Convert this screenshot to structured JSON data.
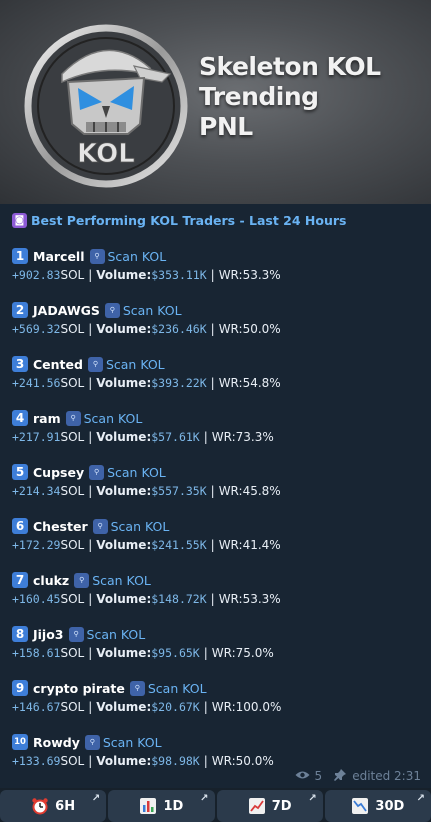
{
  "banner": {
    "title_lines": [
      "Skeleton KOL",
      "Trending",
      "PNL"
    ],
    "logo_text": "KOL"
  },
  "header": {
    "icon": "purple-square-icon",
    "text": "Best Performing KOL Traders - Last 24 Hours"
  },
  "labels": {
    "sol": "SOL",
    "volume": "Volume:",
    "wr": "WR:",
    "scan": "Scan KOL",
    "sep": "|"
  },
  "traders": [
    {
      "rank": "1",
      "name": "Marcell",
      "pnl": "+902.83",
      "volume": "$353.11K",
      "wr": "53.3%"
    },
    {
      "rank": "2",
      "name": "JADAWGS",
      "pnl": "+569.32",
      "volume": "$236.46K",
      "wr": "50.0%"
    },
    {
      "rank": "3",
      "name": "Cented",
      "pnl": "+241.56",
      "volume": "$393.22K",
      "wr": "54.8%"
    },
    {
      "rank": "4",
      "name": "ram",
      "pnl": "+217.91",
      "volume": "$57.61K",
      "wr": "73.3%"
    },
    {
      "rank": "5",
      "name": "Cupsey",
      "pnl": "+214.34",
      "volume": "$557.35K",
      "wr": "45.8%"
    },
    {
      "rank": "6",
      "name": "Chester",
      "pnl": "+172.29",
      "volume": "$241.55K",
      "wr": "41.4%"
    },
    {
      "rank": "7",
      "name": "clukz",
      "pnl": "+160.45",
      "volume": "$148.72K",
      "wr": "53.3%"
    },
    {
      "rank": "8",
      "name": "Jijo3",
      "pnl": "+158.61",
      "volume": "$95.65K",
      "wr": "75.0%"
    },
    {
      "rank": "9",
      "name": "crypto pirate",
      "pnl": "+146.67",
      "volume": "$20.67K",
      "wr": "100.0%"
    },
    {
      "rank": "10",
      "name": "Rowdy",
      "pnl": "+133.69",
      "volume": "$98.98K",
      "wr": "50.0%"
    }
  ],
  "meta": {
    "views": "5",
    "edited": "edited 2:31"
  },
  "buttons": [
    {
      "label": "6H",
      "icon": "alarm-clock-icon"
    },
    {
      "label": "1D",
      "icon": "bar-chart-icon"
    },
    {
      "label": "7D",
      "icon": "chart-increasing-icon"
    },
    {
      "label": "30D",
      "icon": "chart-decreasing-icon"
    }
  ],
  "colors": {
    "background": "#17212b",
    "link": "#6ab3f3",
    "rank_badge": "#3e7ed8",
    "button": "#2b3a4b"
  }
}
